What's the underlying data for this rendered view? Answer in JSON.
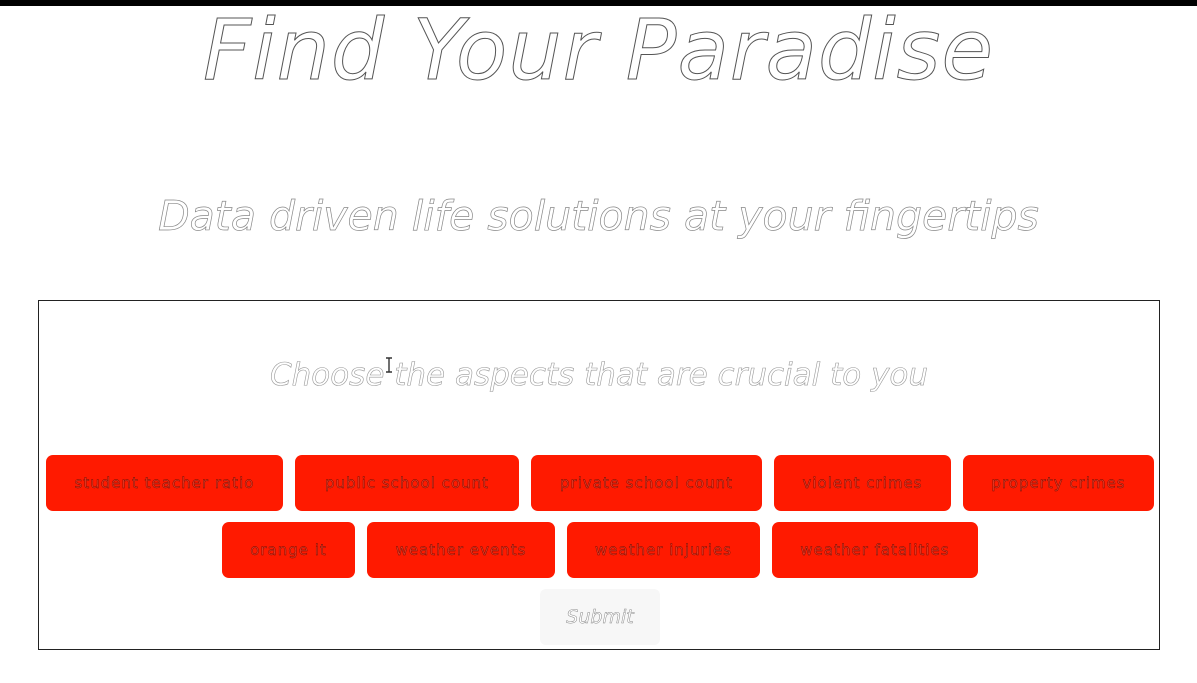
{
  "header": {
    "title": "Find Your Paradise",
    "subtitle": "Data driven life solutions at your fingertips"
  },
  "panel": {
    "prompt": "Choose the aspects that are crucial to you",
    "aspects": [
      "student teacher ratio",
      "public school count",
      "private school count",
      "violent crimes",
      "property crimes",
      "orange it",
      "weather events",
      "weather injuries",
      "weather fatalities"
    ],
    "submit_label": "Submit"
  },
  "colors": {
    "accent": "#ff1a00",
    "topbar": "#000000",
    "panel_border": "#222222"
  },
  "icons": {
    "cursor": "text-cursor-icon"
  }
}
